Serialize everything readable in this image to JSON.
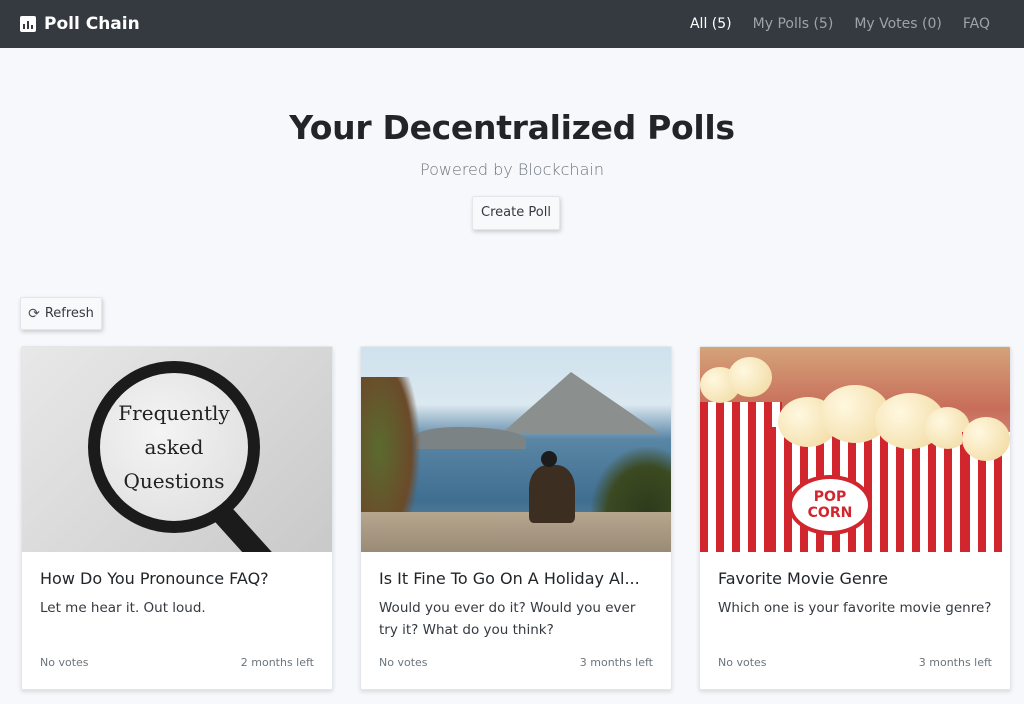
{
  "nav": {
    "brand": "Poll Chain",
    "links": [
      {
        "label": "All (5)",
        "active": true
      },
      {
        "label": "My Polls (5)",
        "active": false
      },
      {
        "label": "My Votes (0)",
        "active": false
      },
      {
        "label": "FAQ",
        "active": false
      }
    ]
  },
  "hero": {
    "title": "Your Decentralized Polls",
    "subtitle": "Powered by Blockchain",
    "create_label": "Create Poll"
  },
  "toolbar": {
    "refresh_label": "Refresh",
    "refresh_icon": "refresh-icon"
  },
  "polls": [
    {
      "title": "How Do You Pronounce FAQ?",
      "description": "Let me hear it. Out loud.",
      "votes": "No votes",
      "time_left": "2 months left",
      "image_text": [
        "Frequently",
        "asked",
        "Questions"
      ]
    },
    {
      "title": "Is It Fine To Go On A Holiday Al...",
      "description": "Would you ever do it? Would you ever try it? What do you think?",
      "votes": "No votes",
      "time_left": "3 months left"
    },
    {
      "title": "Favorite Movie Genre",
      "description": "Which one is your favorite movie genre?",
      "votes": "No votes",
      "time_left": "3 months left",
      "image_text": [
        "POP",
        "CORN"
      ]
    }
  ],
  "colors": {
    "navbar": "#343a40",
    "background": "#f7f8fb",
    "accent_red": "#d2262f"
  }
}
